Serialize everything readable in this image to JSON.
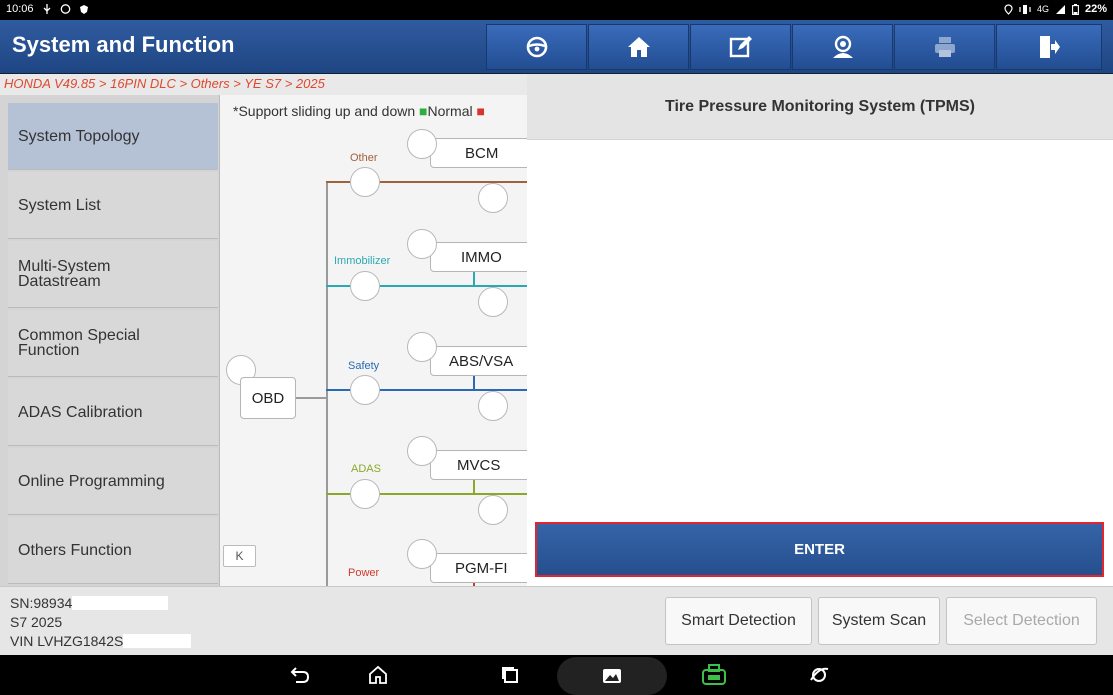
{
  "status_bar": {
    "time": "10:06",
    "battery": "22%",
    "network": "4G"
  },
  "header": {
    "title": "System and Function"
  },
  "toolbar": {
    "icons": [
      "steering-wheel-icon",
      "home-icon",
      "edit-report-icon",
      "support-agent-icon",
      "print-icon",
      "exit-icon"
    ]
  },
  "breadcrumb": "HONDA V49.85 > 16PIN DLC > Others > YE S7 > 2025",
  "sidebar": {
    "items": [
      {
        "label": "System Topology",
        "active": true
      },
      {
        "label": "System List"
      },
      {
        "label": "Multi-System Datastream"
      },
      {
        "label": "Common Special Function"
      },
      {
        "label": "ADAS Calibration"
      },
      {
        "label": "Online Programming"
      },
      {
        "label": "Others Function"
      }
    ]
  },
  "topology": {
    "hint": "*Support sliding up and down",
    "legend_normal": "Normal",
    "root": "OBD",
    "groups": [
      {
        "category": "Other",
        "color": "#a0623a",
        "node": "BCM"
      },
      {
        "category": "Immobilizer",
        "color": "#2aa9b3",
        "node": "IMMO"
      },
      {
        "category": "Safety",
        "color": "#2a6ab5",
        "node": "ABS/VSA"
      },
      {
        "category": "ADAS",
        "color": "#8ba82a",
        "node": "MVCS"
      },
      {
        "category": "Power",
        "color": "#d03a2a",
        "node": "PGM-FI"
      }
    ],
    "collapse_label": "K"
  },
  "dialog": {
    "title": "Tire Pressure Monitoring System (TPMS)",
    "enter_label": "ENTER"
  },
  "vehicle_info": {
    "sn": "SN:98934",
    "model": "S7 2025",
    "vin": "VIN LVHZG1842S"
  },
  "footer_buttons": {
    "smart_detection": "Smart Detection",
    "system_scan": "System Scan",
    "select_detection": "Select Detection"
  }
}
